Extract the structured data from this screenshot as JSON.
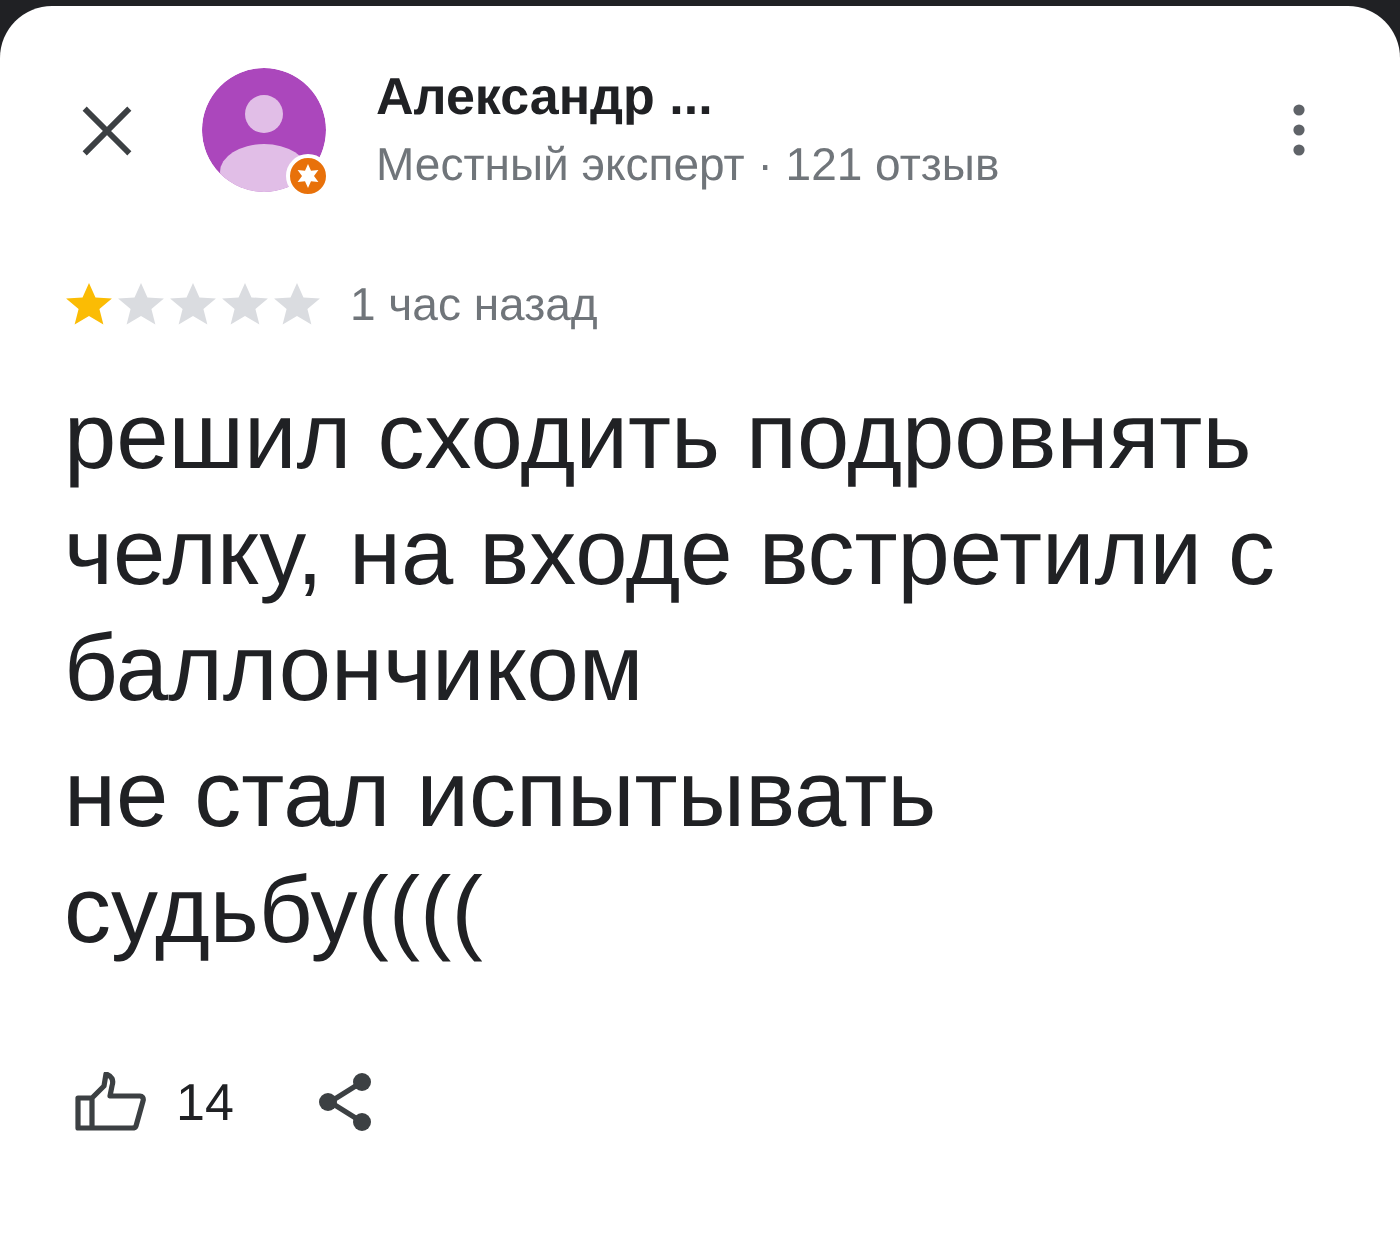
{
  "reviewer": {
    "name": "Александр ...",
    "subtitle": "Местный эксперт · 121 отзыв"
  },
  "review": {
    "stars": 1,
    "time": "1 час назад",
    "paragraphs": [
      "решил сходить подровнять челку, на входе встретили с баллончиком",
      "не стал испытывать судьбу(((("
    ]
  },
  "actions": {
    "likes": "14"
  }
}
